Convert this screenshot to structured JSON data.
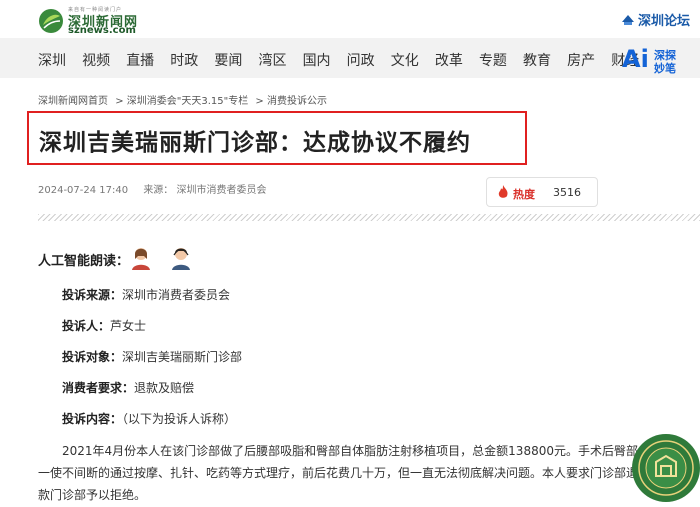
{
  "header": {
    "logo_tagline": "来自有一种阅读门户",
    "logo_cn": "深圳新闻网",
    "logo_en": "sznews.com",
    "forum_link": "深圳论坛"
  },
  "nav": {
    "items": [
      "深圳",
      "视频",
      "直播",
      "时政",
      "要闻",
      "湾区",
      "国内",
      "问政",
      "文化",
      "改革",
      "专题",
      "教育",
      "房产",
      "财经"
    ],
    "brand_line1": "深探",
    "brand_line2": "妙笔"
  },
  "breadcrumb": {
    "items": [
      "深圳新闻网首页",
      "> 深圳消委会\"天天3.15\"专栏",
      "> 消费投诉公示"
    ]
  },
  "article": {
    "title": "深圳吉美瑞丽斯门诊部：达成协议不履约",
    "date": "2024-07-24 17:40",
    "source": "来源：  深圳市消费者委员会",
    "heat_label": "热度",
    "heat_value": "3516",
    "reader_label": "人工智能朗读："
  },
  "complaint": {
    "source_key": "投诉来源：",
    "source_val": "深圳市消费者委员会",
    "person_key": "投诉人：",
    "person_val": "芦女士",
    "target_key": "投诉对象：",
    "target_val": "深圳吉美瑞丽斯门诊部",
    "demand_key": "消费者要求：",
    "demand_val": "退款及赔偿",
    "content_key": "投诉内容：",
    "content_val": "（以下为投诉人诉称）",
    "paragraph": "2021年4月份本人在该门诊部做了后腰部吸脂和臀部自体脂肪注射移植项目，总金额138800元。手术后臀部一使不间断的通过按摩、扎针、吃药等方式理疗，前后花费几十万，但一直无法彻底解决问题。本人要求门诊部退款门诊部予以拒绝。"
  },
  "colors": {
    "accent_red": "#e02020",
    "brand_green": "#2c6a35",
    "link_blue": "#1a5aa8"
  },
  "icons": [
    "logo-leaf-icon",
    "forum-icon",
    "ai-brand-icon",
    "fire-icon",
    "female-voice-avatar-icon",
    "male-voice-avatar-icon",
    "consumer-council-seal-icon"
  ]
}
